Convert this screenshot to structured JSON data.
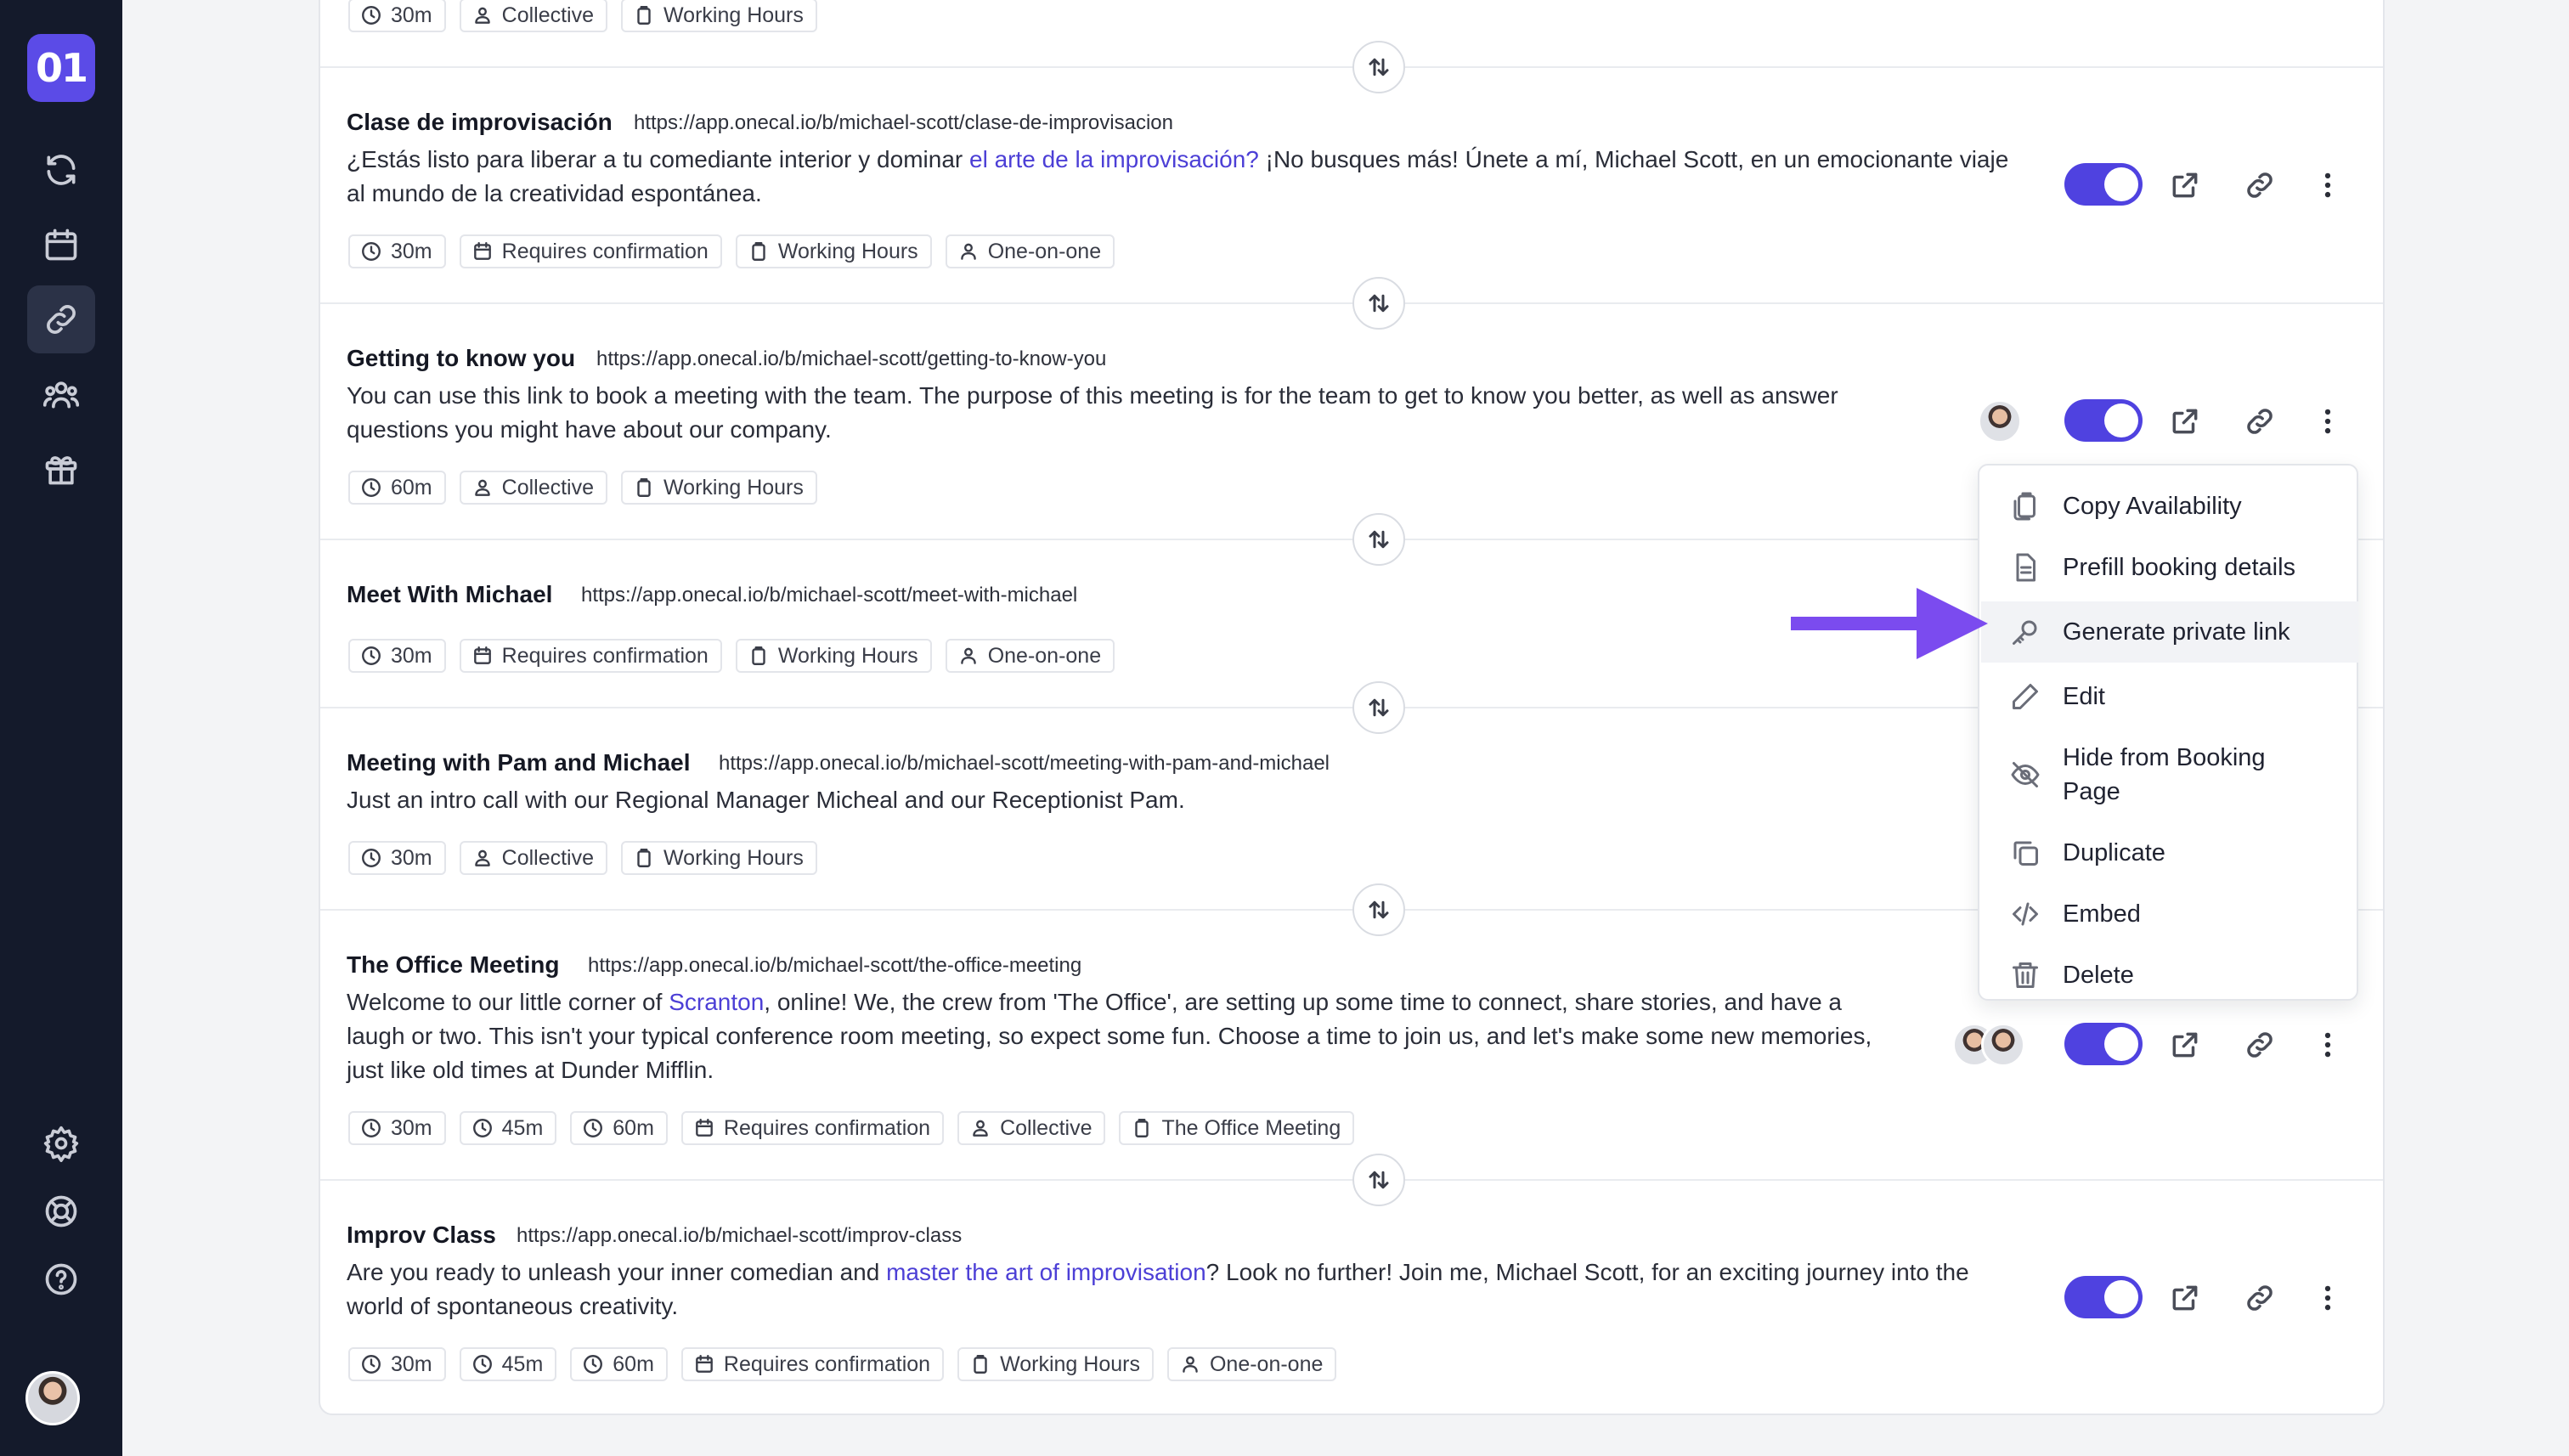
{
  "app": {
    "logo_text": "01",
    "nav": [
      {
        "icon": "sync-icon"
      },
      {
        "icon": "calendar-icon"
      },
      {
        "icon": "link-icon",
        "active": true
      },
      {
        "icon": "team-icon"
      },
      {
        "icon": "gift-icon"
      }
    ],
    "nav_bottom": [
      {
        "icon": "gear-icon"
      },
      {
        "icon": "lifebuoy-icon"
      },
      {
        "icon": "help-icon"
      }
    ],
    "accent_color": "#4f42e0",
    "sidebar_color": "#141a2b"
  },
  "top_row": {
    "tags": [
      "30m",
      "Collective",
      "Working Hours"
    ]
  },
  "rows": [
    {
      "title": "Clase de improvisación",
      "url": "https://app.onecal.io/b/michael-scott/clase-de-improvisacion",
      "desc_before": "¿Estás listo para liberar a tu comediante interior y dominar ",
      "desc_link": "el arte de la improvisación?",
      "desc_after": " ¡No busques más! Únete a mí, Michael Scott, en un emocionante viaje al mundo de la creatividad espontánea.",
      "tags": [
        "30m",
        "Requires confirmation",
        "Working Hours",
        "One-on-one"
      ],
      "enabled": true
    },
    {
      "title": "Getting to know you",
      "url": "https://app.onecal.io/b/michael-scott/getting-to-know-you",
      "desc_before": "You can use this link to book a meeting with the team. The purpose of this meeting is for the team to get to know you better, as well as answer questions you might have about our company.",
      "desc_link": "",
      "desc_after": "",
      "tags": [
        "60m",
        "Collective",
        "Working Hours"
      ],
      "enabled": true
    },
    {
      "title": "Meet With Michael",
      "url": "https://app.onecal.io/b/michael-scott/meet-with-michael",
      "tags": [
        "30m",
        "Requires confirmation",
        "Working Hours",
        "One-on-one"
      ]
    },
    {
      "title": "Meeting with Pam and Michael",
      "url": "https://app.onecal.io/b/michael-scott/meeting-with-pam-and-michael",
      "desc_before": "Just an intro call with our Regional Manager Micheal and our Receptionist Pam.",
      "tags": [
        "30m",
        "Collective",
        "Working Hours"
      ]
    },
    {
      "title": "The Office Meeting",
      "url": "https://app.onecal.io/b/michael-scott/the-office-meeting",
      "desc_before": "Welcome to our little corner of ",
      "desc_link": "Scranton",
      "desc_after": ", online! We, the crew from 'The Office', are setting up some time to connect, share stories, and have a laugh or two. This isn't your typical conference room meeting, so expect some fun. Choose a time to join us, and let's make some new memories, just like old times at Dunder Mifflin.",
      "tags": [
        "30m",
        "45m",
        "60m",
        "Requires confirmation",
        "Collective",
        "The Office Meeting"
      ],
      "enabled": true
    },
    {
      "title": "Improv Class",
      "url": "https://app.onecal.io/b/michael-scott/improv-class",
      "desc_before": "Are you ready to unleash your inner comedian and ",
      "desc_link": "master the art of improvisation",
      "desc_after": "? Look no further! Join me, Michael Scott, for an exciting journey into the world of spontaneous creativity.",
      "tags": [
        "30m",
        "45m",
        "60m",
        "Requires confirmation",
        "Working Hours",
        "One-on-one"
      ],
      "enabled": true
    }
  ],
  "menu": {
    "items": [
      {
        "label": "Copy Availability",
        "icon": "clipboard-copy-icon"
      },
      {
        "label": "Prefill booking details",
        "icon": "document-icon"
      },
      {
        "label": "Generate private link",
        "icon": "key-icon",
        "highlighted": true
      },
      {
        "label": "Edit",
        "icon": "pencil-icon"
      },
      {
        "label": "Hide from Booking Page",
        "icon": "eye-off-icon"
      },
      {
        "label": "Duplicate",
        "icon": "copy-icon"
      },
      {
        "label": "Embed",
        "icon": "code-icon"
      },
      {
        "label": "Delete",
        "icon": "trash-icon"
      }
    ]
  },
  "annotation": {
    "arrow_color": "#7b4bef"
  }
}
